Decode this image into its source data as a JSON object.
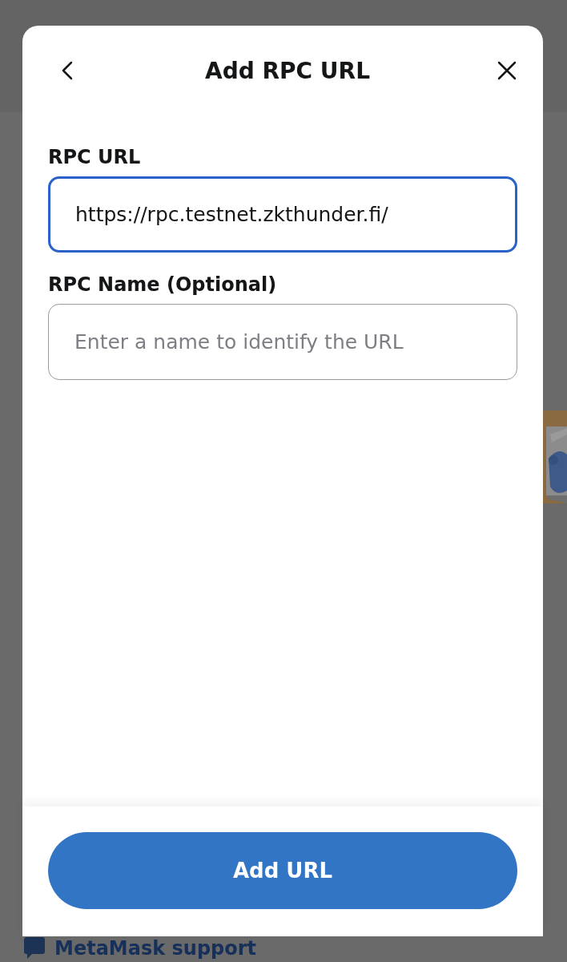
{
  "background": {
    "support_link": "MetaMask support"
  },
  "dialog": {
    "title": "Add RPC URL",
    "fields": [
      {
        "label": "RPC URL",
        "value": "https://rpc.testnet.zkthunder.fi/",
        "focused": true
      },
      {
        "label": "RPC Name (Optional)",
        "placeholder": "Enter a name to identify the URL",
        "focused": false
      }
    ],
    "primary_button": "Add URL"
  }
}
